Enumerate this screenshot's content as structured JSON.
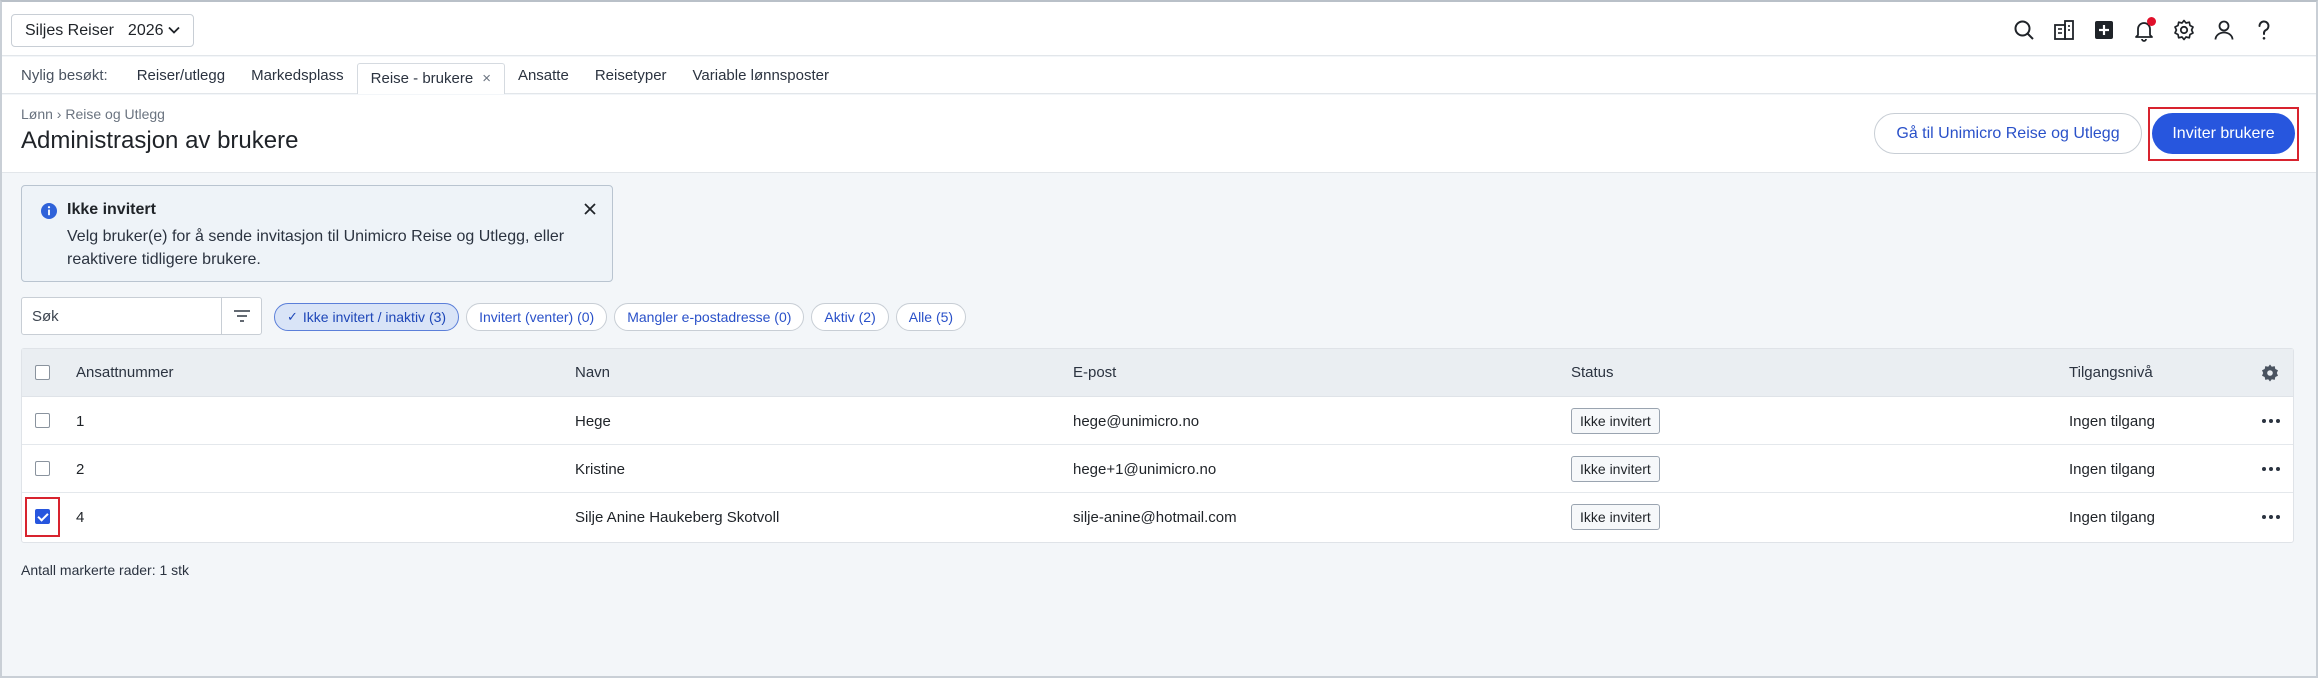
{
  "topbar": {
    "company": "Siljes Reiser",
    "year": "2026",
    "icons": [
      "search-icon",
      "company-icon",
      "add-icon",
      "bell-icon",
      "gear-icon",
      "user-icon",
      "help-icon"
    ]
  },
  "recent": {
    "label": "Nylig besøkt:",
    "tabs": [
      "Reiser/utlegg",
      "Markedsplass",
      "Reise - brukere",
      "Ansatte",
      "Reisetyper",
      "Variable lønnsposter"
    ],
    "close_glyph": "×"
  },
  "header": {
    "breadcrumb": "Lønn › Reise og Utlegg",
    "title": "Administrasjon av brukere",
    "goto_button": "Gå til Unimicro Reise og Utlegg",
    "invite_button": "Inviter brukere"
  },
  "info": {
    "title": "Ikke invitert",
    "text": "Velg bruker(e) for å sende invitasjon til Unimicro Reise og Utlegg, eller reaktivere tidligere brukere."
  },
  "search": {
    "placeholder": "Søk"
  },
  "chips": [
    "Ikke invitert / inaktiv (3)",
    "Invitert (venter) (0)",
    "Mangler e-postadresse (0)",
    "Aktiv (2)",
    "Alle (5)"
  ],
  "table": {
    "columns": [
      "Ansattnummer",
      "Navn",
      "E-post",
      "Status",
      "Tilgangsnivå"
    ],
    "rows": [
      {
        "number": "1",
        "name": "Hege",
        "email": "hege@unimicro.no",
        "status": "Ikke invitert",
        "access": "Ingen tilgang",
        "checked": false
      },
      {
        "number": "2",
        "name": "Kristine",
        "email": "hege+1@unimicro.no",
        "status": "Ikke invitert",
        "access": "Ingen tilgang",
        "checked": false
      },
      {
        "number": "4",
        "name": "Silje Anine Haukeberg Skotvoll",
        "email": "silje-anine@hotmail.com",
        "status": "Ikke invitert",
        "access": "Ingen tilgang",
        "checked": true
      }
    ]
  },
  "footer": {
    "selected_count": "Antall markerte rader: 1 stk"
  },
  "colors": {
    "accent": "#2756de",
    "highlight": "#d8232e",
    "notification": "#e0102b"
  }
}
